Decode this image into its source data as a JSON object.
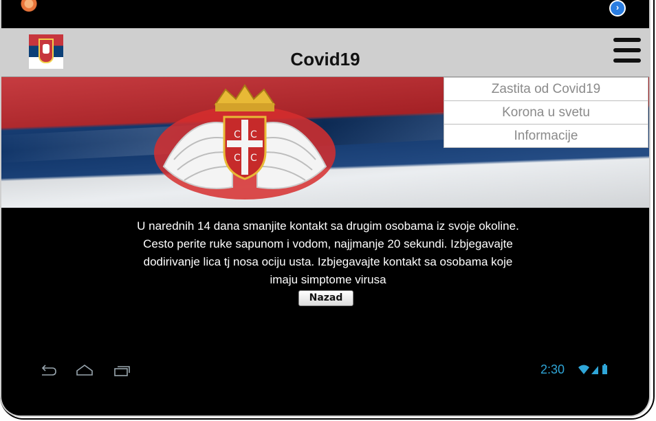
{
  "app": {
    "title": "Covid19"
  },
  "header": {
    "menu_icon": "hamburger-menu-icon",
    "logo_icon": "serbian-flag-logo"
  },
  "dropdown_menu": {
    "items": [
      {
        "label": "Zastita od Covid19"
      },
      {
        "label": "Korona u svetu"
      },
      {
        "label": "Informacije"
      }
    ]
  },
  "main": {
    "text": "U narednih 14 dana smanjite kontakt sa drugim osobama iz svoje okoline. Cesto perite ruke sapunom i vodom, najjmanje 20 sekundi. Izbjegavajte dodirivanje lica tj nosa ociju usta. Izbjegavajte kontakt sa osobama koje imaju simptome virusa",
    "back_button": "Nazad"
  },
  "system_bar": {
    "time": "2:30",
    "icons": [
      "back-icon",
      "home-icon",
      "recent-apps-icon",
      "wifi-icon",
      "signal-icon",
      "battery-icon"
    ]
  },
  "colors": {
    "header_bg": "#cfcfcf",
    "screen_bg": "#000000",
    "clock": "#2fa6d8",
    "flag_red": "#c0262b",
    "flag_blue": "#123d7a",
    "flag_white": "#e9ecef"
  }
}
